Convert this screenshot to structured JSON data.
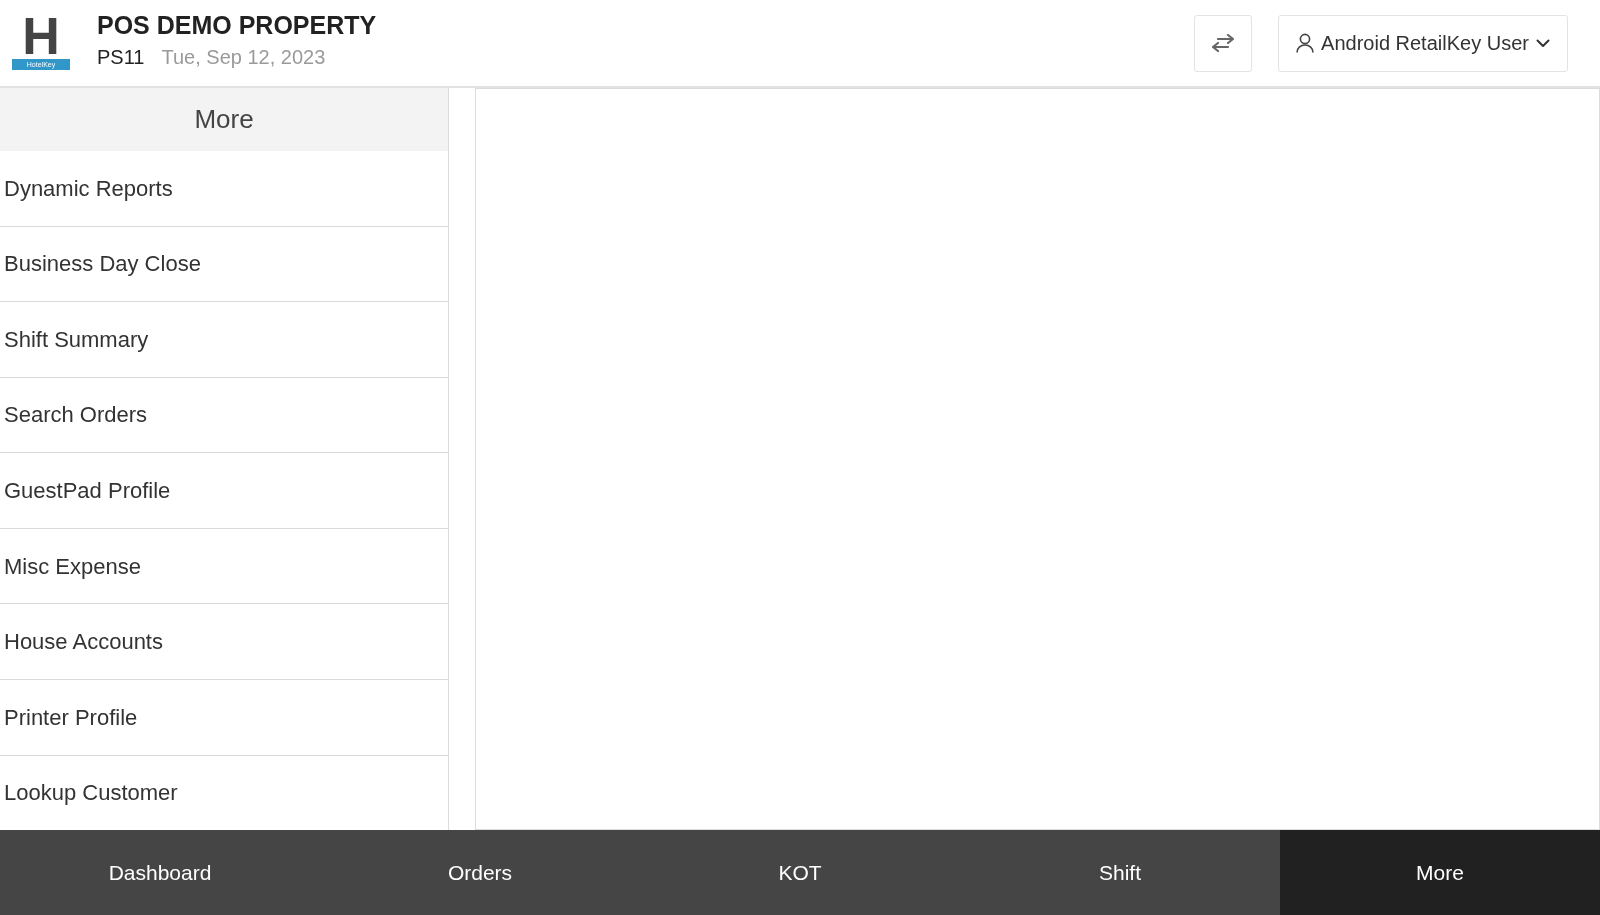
{
  "header": {
    "logo": {
      "letter": "H",
      "caption": "HotelKey"
    },
    "property_name": "POS DEMO PROPERTY",
    "station": "PS11",
    "date": "Tue, Sep 12, 2023",
    "user_menu": {
      "label": "Android RetailKey User"
    }
  },
  "sidebar": {
    "title": "More",
    "items": [
      {
        "label": "Dynamic Reports"
      },
      {
        "label": "Business Day Close"
      },
      {
        "label": "Shift Summary"
      },
      {
        "label": "Search Orders"
      },
      {
        "label": "GuestPad Profile"
      },
      {
        "label": "Misc Expense"
      },
      {
        "label": "House Accounts"
      },
      {
        "label": "Printer Profile"
      },
      {
        "label": "Lookup Customer"
      }
    ]
  },
  "bottom_nav": [
    {
      "label": "Dashboard",
      "selected": false
    },
    {
      "label": "Orders",
      "selected": false
    },
    {
      "label": "KOT",
      "selected": false
    },
    {
      "label": "Shift",
      "selected": false
    },
    {
      "label": "More",
      "selected": true
    }
  ]
}
